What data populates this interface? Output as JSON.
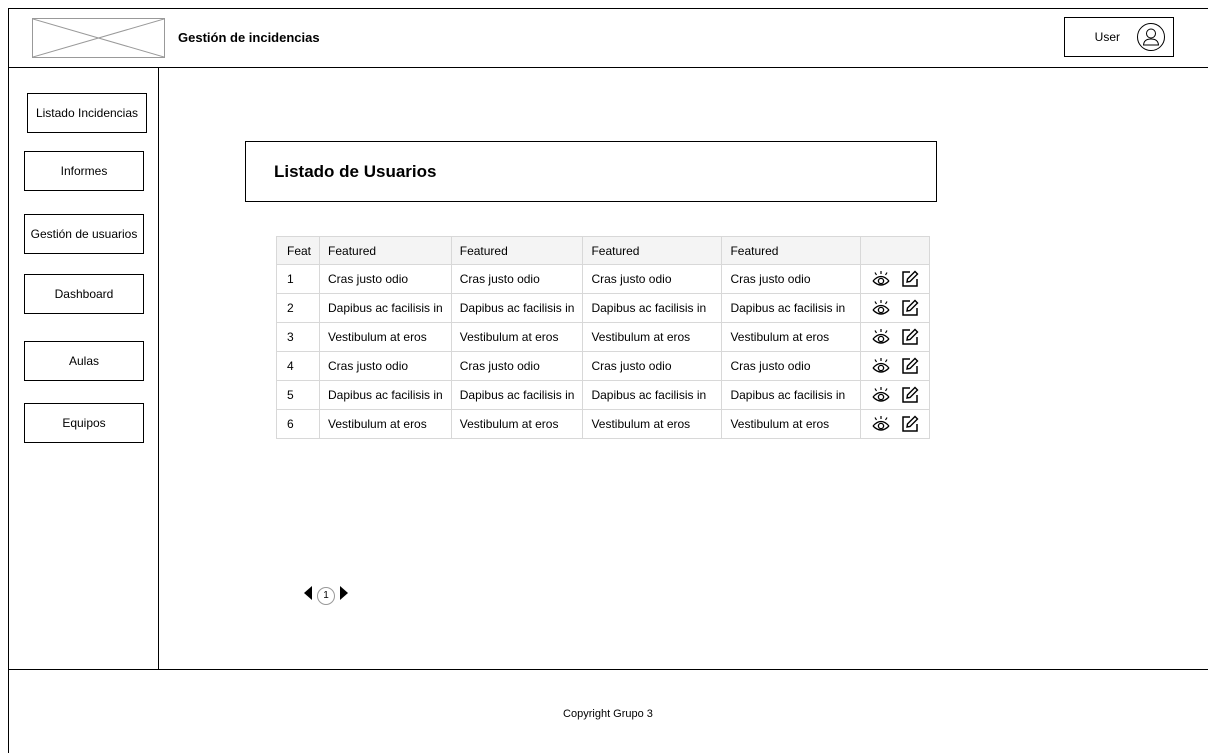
{
  "header": {
    "title": "Gestión de incidencias",
    "user_label": "User",
    "logo_icon": "image-placeholder-icon",
    "avatar_icon": "user-avatar-icon"
  },
  "sidebar": {
    "items": [
      {
        "label": "Listado Incidencias"
      },
      {
        "label": "Informes"
      },
      {
        "label": "Gestión de usuarios"
      },
      {
        "label": "Dashboard"
      },
      {
        "label": "Aulas"
      },
      {
        "label": "Equipos"
      }
    ]
  },
  "main": {
    "title": "Listado de Usuarios",
    "table": {
      "headers": [
        "Feat",
        "Featured",
        "Featured",
        "Featured",
        "Featured",
        ""
      ],
      "rows": [
        [
          "1",
          "Cras justo odio",
          "Cras justo odio",
          "Cras justo odio",
          "Cras justo odio"
        ],
        [
          "2",
          "Dapibus ac facilisis in",
          "Dapibus ac facilisis in",
          "Dapibus ac facilisis in",
          "Dapibus ac facilisis in"
        ],
        [
          "3",
          "Vestibulum at eros",
          "Vestibulum at eros",
          "Vestibulum at eros",
          "Vestibulum at eros"
        ],
        [
          "4",
          "Cras justo odio",
          "Cras justo odio",
          "Cras justo odio",
          "Cras justo odio"
        ],
        [
          "5",
          "Dapibus ac facilisis in",
          "Dapibus ac facilisis in",
          "Dapibus ac facilisis in",
          "Dapibus ac facilisis in"
        ],
        [
          "6",
          "Vestibulum at eros",
          "Vestibulum at eros",
          "Vestibulum at eros",
          "Vestibulum at eros"
        ]
      ],
      "row_action_icons": [
        "view-eye-icon",
        "edit-icon"
      ]
    },
    "pagination": {
      "current_page": "1",
      "prev_icon": "triangle-left-icon",
      "next_icon": "triangle-right-icon"
    }
  },
  "footer": {
    "copyright": "Copyright Grupo 3"
  }
}
